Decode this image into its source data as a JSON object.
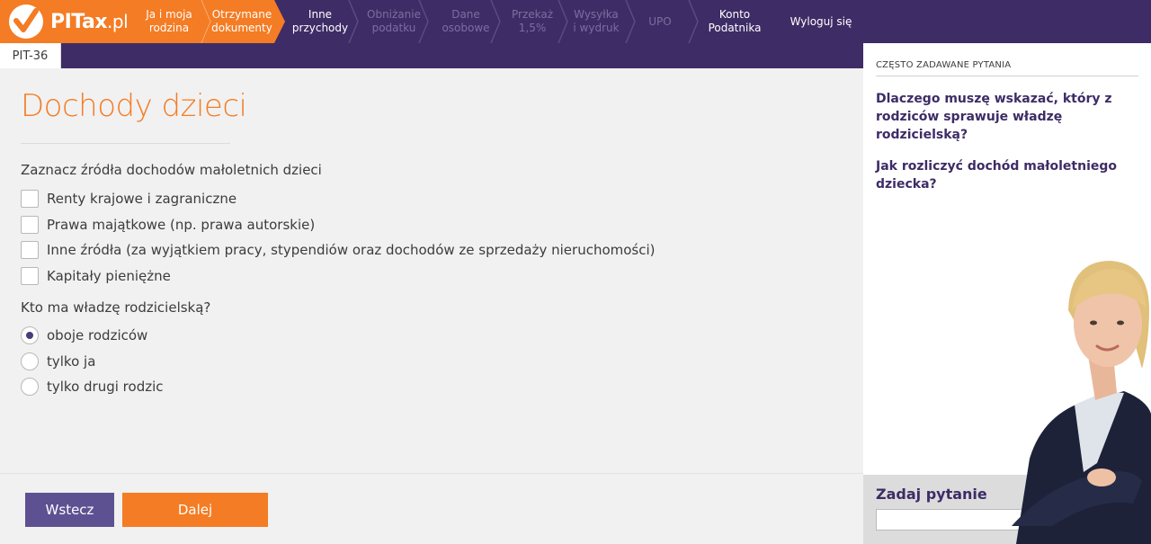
{
  "app": {
    "logo_main": "PITax",
    "logo_suffix": ".pl"
  },
  "nav": {
    "steps": [
      {
        "label": "Ja i moja\nrodzina",
        "state": "done"
      },
      {
        "label": "Otrzymane\ndokumenty",
        "state": "done"
      },
      {
        "label": "Inne\nprzychody",
        "state": "current"
      },
      {
        "label": "Obniżanie\npodatku",
        "state": "future"
      },
      {
        "label": "Dane\nosobowe",
        "state": "future"
      },
      {
        "label": "Przekaż\n1,5%",
        "state": "future"
      },
      {
        "label": "Wysyłka\ni wydruk",
        "state": "future"
      },
      {
        "label": "UPO",
        "state": "future"
      }
    ],
    "account": "Konto\nPodatnika",
    "logout": "Wyloguj się"
  },
  "form_tab": "PIT-36",
  "main": {
    "title": "Dochody dzieci",
    "sources_question": "Zaznacz źródła dochodów małoletnich dzieci",
    "sources": [
      {
        "label": "Renty krajowe i zagraniczne",
        "checked": false
      },
      {
        "label": "Prawa majątkowe (np. prawa autorskie)",
        "checked": false
      },
      {
        "label": "Inne źródła (za wyjątkiem pracy, stypendiów oraz dochodów ze sprzedaży nieruchomości)",
        "checked": false
      },
      {
        "label": "Kapitały pieniężne",
        "checked": false
      }
    ],
    "authority_question": "Kto ma władzę rodzicielską?",
    "authority_options": [
      {
        "label": "oboje rodziców",
        "checked": true
      },
      {
        "label": "tylko ja",
        "checked": false
      },
      {
        "label": "tylko drugi rodzic",
        "checked": false
      }
    ]
  },
  "footer": {
    "back_label": "Wstecz",
    "next_label": "Dalej"
  },
  "sidebar": {
    "faq_heading": "CZĘSTO ZADAWANE PYTANIA",
    "faq_items": [
      "Dlaczego muszę wskazać, który z rodziców sprawuje władzę rodzicielską?",
      "Jak rozliczyć dochód małoletniego dziecka?"
    ],
    "ask_label": "Zadaj pytanie",
    "ask_placeholder": ""
  },
  "colors": {
    "brand_orange": "#f47c24",
    "brand_purple": "#3e2c66",
    "button_purple": "#5e5192"
  }
}
